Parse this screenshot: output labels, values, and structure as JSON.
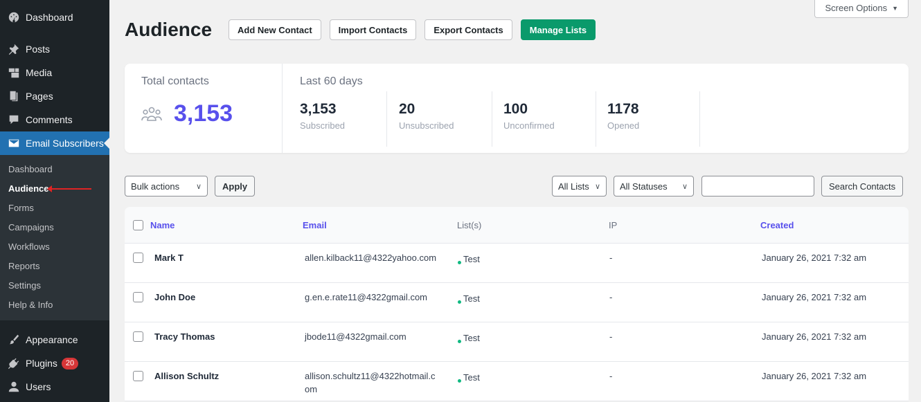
{
  "sidebar": {
    "top_items": [
      {
        "label": "Dashboard",
        "icon": "dashboard-icon"
      },
      {
        "label": "Posts",
        "icon": "pin-icon"
      },
      {
        "label": "Media",
        "icon": "media-icon"
      },
      {
        "label": "Pages",
        "icon": "pages-icon"
      },
      {
        "label": "Comments",
        "icon": "comment-icon"
      },
      {
        "label": "Email Subscribers",
        "icon": "envelope-icon"
      }
    ],
    "submenu": [
      "Dashboard",
      "Audience",
      "Forms",
      "Campaigns",
      "Workflows",
      "Reports",
      "Settings",
      "Help & Info"
    ],
    "bottom_items": [
      {
        "label": "Appearance",
        "icon": "brush-icon"
      },
      {
        "label": "Plugins",
        "icon": "plugin-icon",
        "badge": "20"
      },
      {
        "label": "Users",
        "icon": "user-icon"
      }
    ]
  },
  "screen_options": "Screen Options",
  "header": {
    "title": "Audience",
    "buttons": [
      "Add New Contact",
      "Import Contacts",
      "Export Contacts",
      "Manage Lists"
    ]
  },
  "stats": {
    "total_label": "Total contacts",
    "total_value": "3,153",
    "period_label": "Last 60 days",
    "metrics": [
      {
        "value": "3,153",
        "label": "Subscribed"
      },
      {
        "value": "20",
        "label": "Unsubscribed"
      },
      {
        "value": "100",
        "label": "Unconfirmed"
      },
      {
        "value": "1178",
        "label": "Opened"
      }
    ]
  },
  "filters": {
    "bulk_actions": "Bulk actions",
    "apply": "Apply",
    "all_lists": "All Lists",
    "all_statuses": "All Statuses",
    "search_value": "",
    "search_button": "Search Contacts"
  },
  "table": {
    "columns": [
      "Name",
      "Email",
      "List(s)",
      "IP",
      "Created"
    ],
    "rows": [
      {
        "name": "Mark T",
        "email": "allen.kilback11@4322yahoo.com",
        "list": "Test",
        "ip": "-",
        "created": "January 26, 2021 7:32 am"
      },
      {
        "name": "John Doe",
        "email": "g.en.e.rate11@4322gmail.com",
        "list": "Test",
        "ip": "-",
        "created": "January 26, 2021 7:32 am"
      },
      {
        "name": "Tracy Thomas",
        "email": "jbode11@4322gmail.com",
        "list": "Test",
        "ip": "-",
        "created": "January 26, 2021 7:32 am"
      },
      {
        "name": "Allison Schultz",
        "email": "allison.schultz11@4322hotmail.com",
        "list": "Test",
        "ip": "-",
        "created": "January 26, 2021 7:32 am"
      }
    ]
  },
  "colors": {
    "accent": "#5850ec",
    "primary_button": "#0a9a6b",
    "sidebar_bg": "#1d2327",
    "active_menu": "#2271b1"
  }
}
